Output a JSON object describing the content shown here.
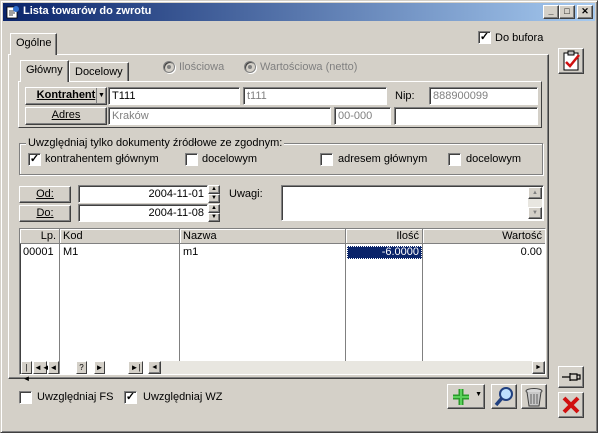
{
  "window": {
    "title": "Lista towarów do zwrotu"
  },
  "tabs": {
    "main": "Ogólne"
  },
  "buffer_checkbox": {
    "label": "Do bufora",
    "checked": true
  },
  "subtabs": [
    "Główny",
    "Docelowy"
  ],
  "value_mode": {
    "option1": "Ilościowa",
    "option2": "Wartościowa (netto)"
  },
  "contractor": {
    "button": "Kontrahent",
    "code": "T111",
    "name": "t111",
    "nip_label": "Nip:",
    "nip": "888900099"
  },
  "address": {
    "button": "Adres",
    "city": "Kraków",
    "zip": "00-000",
    "extra": ""
  },
  "filter_group": {
    "title": "Uwzględniaj tylko dokumenty źródłowe ze zgodnym:",
    "options": [
      {
        "label": "kontrahentem głównym",
        "checked": true
      },
      {
        "label": "docelowym",
        "checked": false
      },
      {
        "label": "adresem głównym",
        "checked": false
      },
      {
        "label": "docelowym",
        "checked": false
      }
    ]
  },
  "dates": {
    "from_label": "Od:",
    "from": "2004-11-01",
    "to_label": "Do:",
    "to": "2004-11-08"
  },
  "notes": {
    "label": "Uwagi:",
    "value": ""
  },
  "table": {
    "columns": [
      "Lp.",
      "Kod",
      "Nazwa",
      "Ilość",
      "Wartość"
    ],
    "rows": [
      {
        "lp": "00001",
        "kod": "M1",
        "nazwa": "m1",
        "ilosc": "-6.0000",
        "wartosc": "0.00"
      }
    ]
  },
  "navigator": [
    "|◄",
    "◄◄",
    "◄",
    "?",
    "►",
    "►|"
  ],
  "bottom": {
    "include_fs": {
      "label": "Uwzględniaj FS",
      "checked": false
    },
    "include_wz": {
      "label": "Uwzględniaj WZ",
      "checked": true
    }
  },
  "icons": {
    "confirm": "checklist-icon",
    "add": "plus-icon",
    "search": "magnifier-icon",
    "delete": "trash-icon",
    "pin": "pin-icon",
    "close": "close-x-icon"
  },
  "colors": {
    "title_start": "#0a246a",
    "title_end": "#a6caf0",
    "selection": "#0a246a",
    "add_green": "#2a9a2a",
    "close_red": "#d01010"
  }
}
